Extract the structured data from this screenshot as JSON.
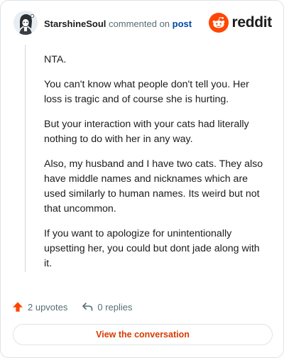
{
  "header": {
    "username": "StarshineSoul",
    "action_text": "commented on",
    "post_link": "post",
    "brand": "reddit"
  },
  "comment": {
    "paragraphs": [
      "NTA.",
      "You can't know what people don't tell you. Her loss is tragic and of course she is hurting.",
      "But your interaction with your cats had literally nothing to do with her in any way.",
      "Also, my husband and I have two cats. They also have middle names and nicknames which are used similarly to human names. Its weird but not that uncommon.",
      "If you want to apologize for unintentionally upsetting her, you could but dont jade along with it."
    ]
  },
  "actions": {
    "upvotes": "2 upvotes",
    "replies": "0 replies"
  },
  "cta": {
    "label": "View the conversation"
  },
  "colors": {
    "brand_orange": "#ff4500",
    "link_blue": "#0045ac",
    "cta_text": "#d93a00",
    "muted": "#576f76"
  },
  "icons": [
    "avatar",
    "reddit-logo-icon",
    "upvote-arrow-icon",
    "reply-arrow-icon"
  ]
}
